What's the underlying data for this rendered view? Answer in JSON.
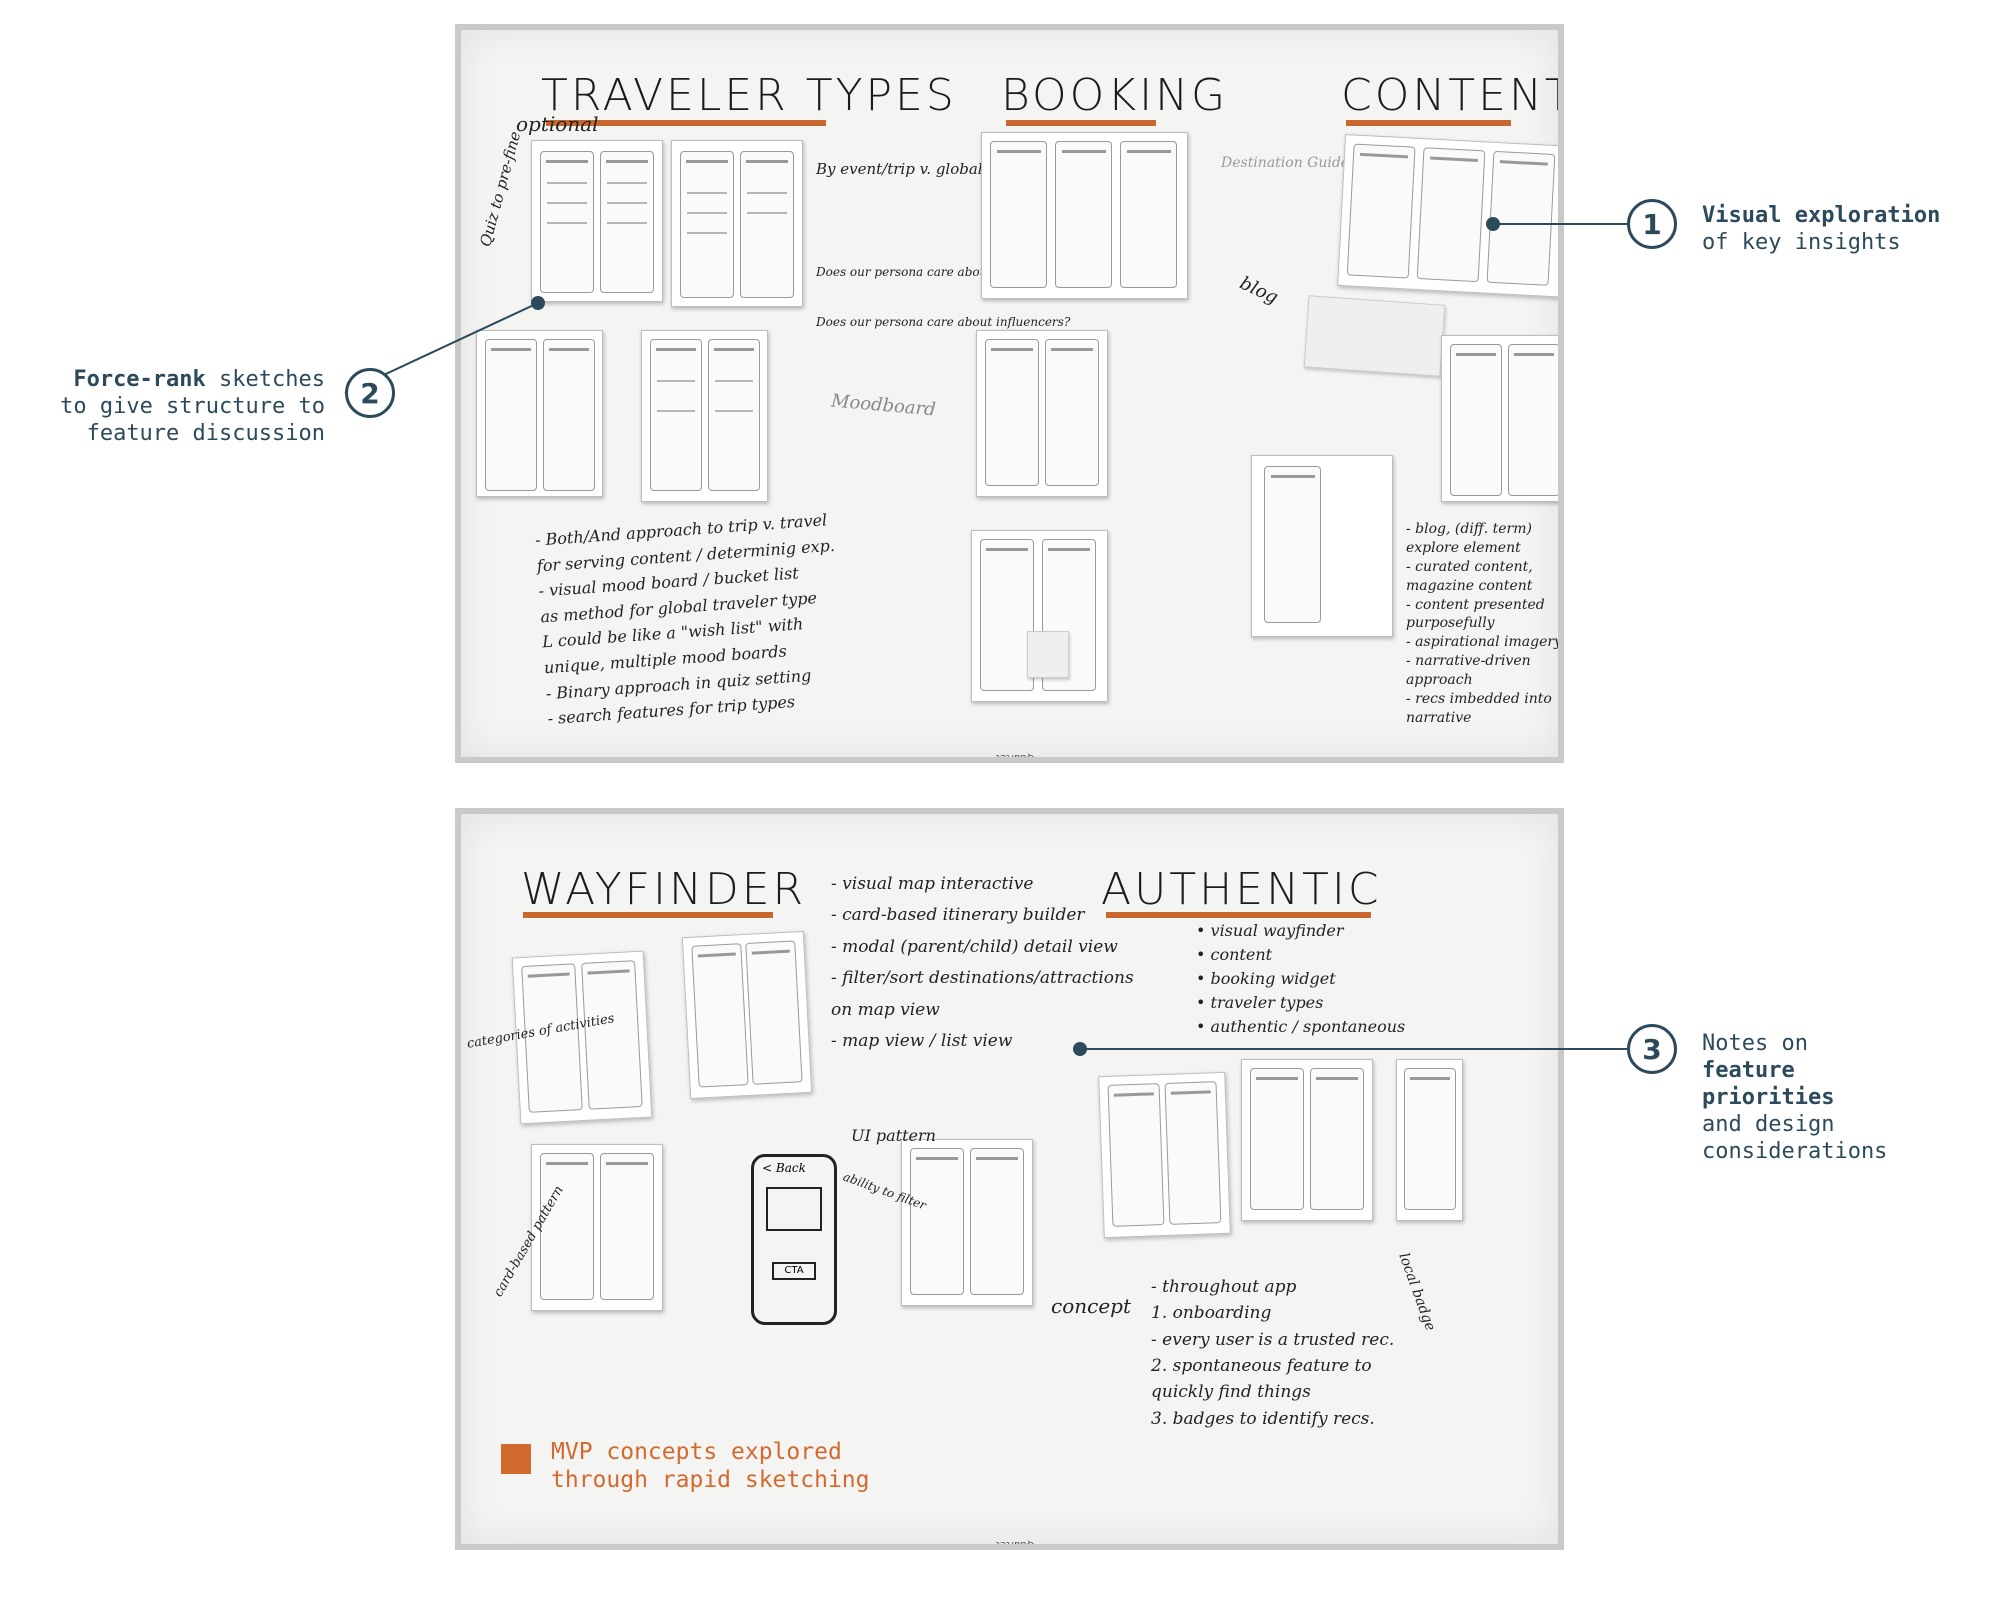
{
  "boards": {
    "top": {
      "headings": [
        "TRAVELER TYPES",
        "BOOKING",
        "CONTENT"
      ],
      "handwriting": {
        "optional": "optional",
        "quiz": "Quiz to pre-fine",
        "by_event": "By event/trip v. global type",
        "pets": "Does our persona care about pets?",
        "influencers": "Does our persona care about influencers?",
        "moodboard": "Moodboard",
        "destination_guide": "Destination Guide",
        "blog": "blog",
        "brand": "Quartet"
      },
      "notes_left": [
        "- Both/And approach to trip v. travel",
        "  for serving content / determinig exp.",
        "- visual mood board / bucket list",
        "  as method for global traveler type",
        "  L could be like a \"wish list\" with",
        "  unique, multiple mood boards",
        "- Binary approach in quiz setting",
        "- search features for trip types"
      ],
      "notes_right": [
        "- blog, (diff. term)",
        "explore element",
        "- curated content,",
        "magazine content",
        "- content presented",
        "purposefully",
        "- aspirational imagery",
        "- narrative-driven",
        "approach",
        "- recs imbedded into",
        "narrative"
      ]
    },
    "bottom": {
      "headings": [
        "WAYFINDER",
        "AUTHENTIC"
      ],
      "wayfinder_notes": [
        "- visual map interactive",
        "- card-based itinerary builder",
        "- modal (parent/child) detail view",
        "- filter/sort destinations/attractions",
        "  on map view",
        "- map view / list view"
      ],
      "authentic_list": [
        "• visual wayfinder",
        "• content",
        "• booking widget",
        "• traveler types",
        "• authentic / spontaneous"
      ],
      "authentic_notes": [
        "- throughout app",
        "1. onboarding",
        "  - every user is a trusted rec.",
        "2. spontaneous feature to",
        "  quickly find things",
        "3. badges to identify recs."
      ],
      "handwriting": {
        "categories": "categories of activities",
        "card_based": "card-based pattern",
        "ui_pattern": "UI pattern",
        "ability": "ability to filter",
        "concept": "concept",
        "local_badge": "local badge",
        "back": "< Back",
        "cta": "CTA",
        "brand": "Quartet"
      }
    }
  },
  "callouts": [
    {
      "number": "1",
      "bold": "Visual exploration",
      "rest": "of key insights"
    },
    {
      "number": "2",
      "bold": "Force-rank",
      "rest_line1": "sketches",
      "rest_line2": "to give structure to",
      "rest_line3": "feature discussion"
    },
    {
      "number": "3",
      "line1": "Notes on",
      "bold_line2": "feature",
      "bold_line3": "priorities",
      "line4": "and design",
      "line5": "considerations"
    }
  ],
  "legend": {
    "line1": "MVP concepts explored",
    "line2": "through rapid sketching",
    "color": "#d26a2e"
  },
  "colors": {
    "callout": "#2d4a5c",
    "accent": "#c9682e"
  }
}
